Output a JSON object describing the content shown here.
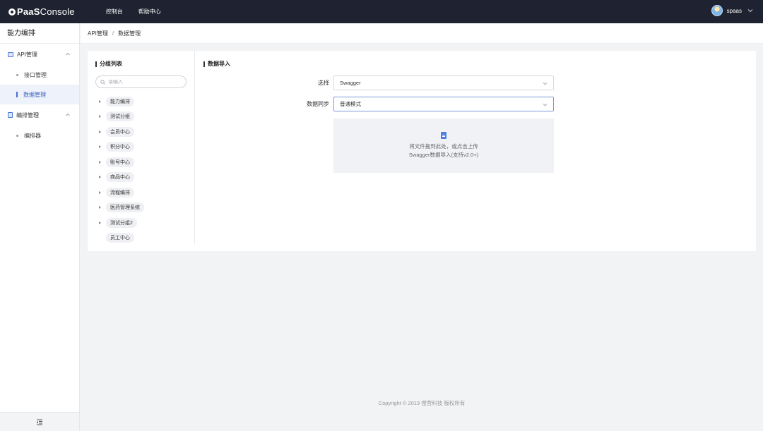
{
  "app": {
    "brand_strong": "PaaS",
    "brand_rest": " Console"
  },
  "nav": {
    "items": [
      "控制台",
      "帮助中心"
    ]
  },
  "user": {
    "name": "spaas"
  },
  "sidebar": {
    "title": "能力编排",
    "groups": [
      {
        "label": "API管理",
        "items": [
          {
            "label": "接口管理",
            "active": false
          },
          {
            "label": "数据管理",
            "active": true
          }
        ]
      },
      {
        "label": "编排管理",
        "items": [
          {
            "label": "编排器",
            "active": false
          }
        ]
      }
    ]
  },
  "breadcrumb": {
    "items": [
      "API管理",
      "数据管理"
    ],
    "separator": "/"
  },
  "left_panel": {
    "title": "分组列表",
    "search_placeholder": "请输入",
    "tree": [
      {
        "label": "能力编排",
        "expandable": true
      },
      {
        "label": "测试分组",
        "expandable": true
      },
      {
        "label": "会员中心",
        "expandable": true
      },
      {
        "label": "积分中心",
        "expandable": true
      },
      {
        "label": "账号中心",
        "expandable": true
      },
      {
        "label": "商品中心",
        "expandable": true
      },
      {
        "label": "流程编排",
        "expandable": true
      },
      {
        "label": "医药管理系统",
        "expandable": true
      },
      {
        "label": "测试分组2",
        "expandable": true
      },
      {
        "label": "员工中心",
        "expandable": false
      }
    ]
  },
  "right_panel": {
    "title": "数据导入",
    "select_label": "选择",
    "select_value": "Swagger",
    "sync_label": "数据同步",
    "sync_value": "普通模式",
    "upload_line1": "将文件拖到此处，或点击上传",
    "upload_line2": "Swagger数据导入(支持v2.0+)"
  },
  "footer": {
    "text": "Copyright © 2019 搜营科技 版权所有"
  },
  "colors": {
    "topbar": "#1f2230",
    "accent": "#4a6fd4",
    "page_bg": "#f2f3f5"
  }
}
